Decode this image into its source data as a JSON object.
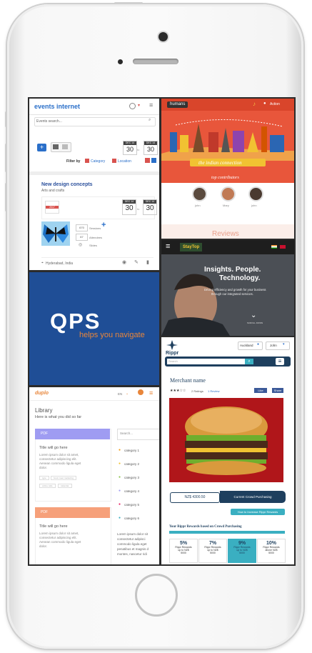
{
  "panel_events": {
    "logo": "events internet",
    "search_placeholder": "Events search...",
    "filter_by": "Filter by",
    "category": "Category",
    "location": "Location",
    "date_from_month": "DEC 14",
    "date_from_day": "30",
    "date_to_month": "DEC 14",
    "date_to_day": "30",
    "event_title": "New design concepts",
    "event_subtitle": "Arts and crafts",
    "event_badge": "2017",
    "card_from_month": "DEC 14",
    "card_from_day": "30",
    "card_to_word": "to",
    "card_to_month": "DEC 14",
    "card_to_day": "30",
    "stat1_value": "670",
    "stat1_label": "Sessions",
    "stat2_value": "67",
    "stat2_label": "Attendees",
    "stat3_label": "Slides",
    "location_text": "Hyderabad, India",
    "to_word": "to"
  },
  "panel_humans": {
    "logo": "humans",
    "nav_action": "Action",
    "banner_title": "the indian connection",
    "subtitle": "top contributors",
    "contributors": [
      "john",
      "Mary",
      "john"
    ],
    "reviews": "Reviews",
    "accent": "#e8563b"
  },
  "panel_staytop": {
    "logo": "StayTop",
    "headline1": "Insights. People.",
    "headline2": "Technology.",
    "body1": "Driving efficiency and growth for your business",
    "body2": "through our integrated services.",
    "scroll": "SCROLL DOWN"
  },
  "panel_qps": {
    "logo": "QPS",
    "tagline": "helps you navigate",
    "bg": "#1f4e96",
    "accent": "#e8863b"
  },
  "panel_rippr": {
    "logo": "Rippr",
    "city": "Auckland",
    "user": "John",
    "search_placeholder": "Search",
    "merchant": "Merchant name",
    "ratings": "2 Ratings",
    "review_link": "1 Review",
    "like": "Like",
    "share": "Share",
    "price": "NZ$ 4300.50",
    "cta": "Current Crowd Purchasing",
    "cta2": "How to Increase Rippr Rewards",
    "rewards_title": "Your Rippr Rewards based on Crowd Purchasing",
    "rewards": [
      {
        "pct": "5%",
        "line1": "Rippr Rewards",
        "line2": "up to NZ$",
        "line3": "5000"
      },
      {
        "pct": "7%",
        "line1": "Rippr Rewards",
        "line2": "up to NZ$",
        "line3": "5000"
      },
      {
        "pct": "9%",
        "line1": "Rippr Rewards",
        "line2": "up to NZ$",
        "line3": "5000"
      },
      {
        "pct": "10%",
        "line1": "Rippr Rewards",
        "line2": "above NZ$",
        "line3": "5000"
      }
    ]
  },
  "panel_library": {
    "logo": "duplo",
    "lang": "EN",
    "title": "Library",
    "subtitle": "Here is what you did so far",
    "search_placeholder": "Search...",
    "card1_tag": "PDF",
    "card1_title": "Title will go here",
    "card1_body1": "Lorem ipsum dolor sit amet,",
    "card1_body2": "consectetur adipiscing elit.",
    "card1_body3": "Aenean commodo ligula eget",
    "card1_body4": "dolor.",
    "chips": [
      "type",
      "book meet marketing",
      "online cafe",
      "calendar"
    ],
    "card2_tag": "PDF",
    "card2_title": "Title will go here",
    "card2_body1": "Lorem ipsum dolor sit amet,",
    "card2_body2": "consectetur adipiscing elit.",
    "card2_body3": "Aenean commodo ligula eget",
    "card2_body4": "dolor.",
    "categories": [
      "category 1",
      "category 2",
      "category 3",
      "category 4",
      "category 5",
      "category 6"
    ],
    "side_text1": "Lorem ipsum dolor sit",
    "side_text2": "consectetur adipisci",
    "side_text3": "commodo ligula eget",
    "side_text4": "penatibus et magnis d",
    "side_text5": "montes, nascetur ridi"
  }
}
